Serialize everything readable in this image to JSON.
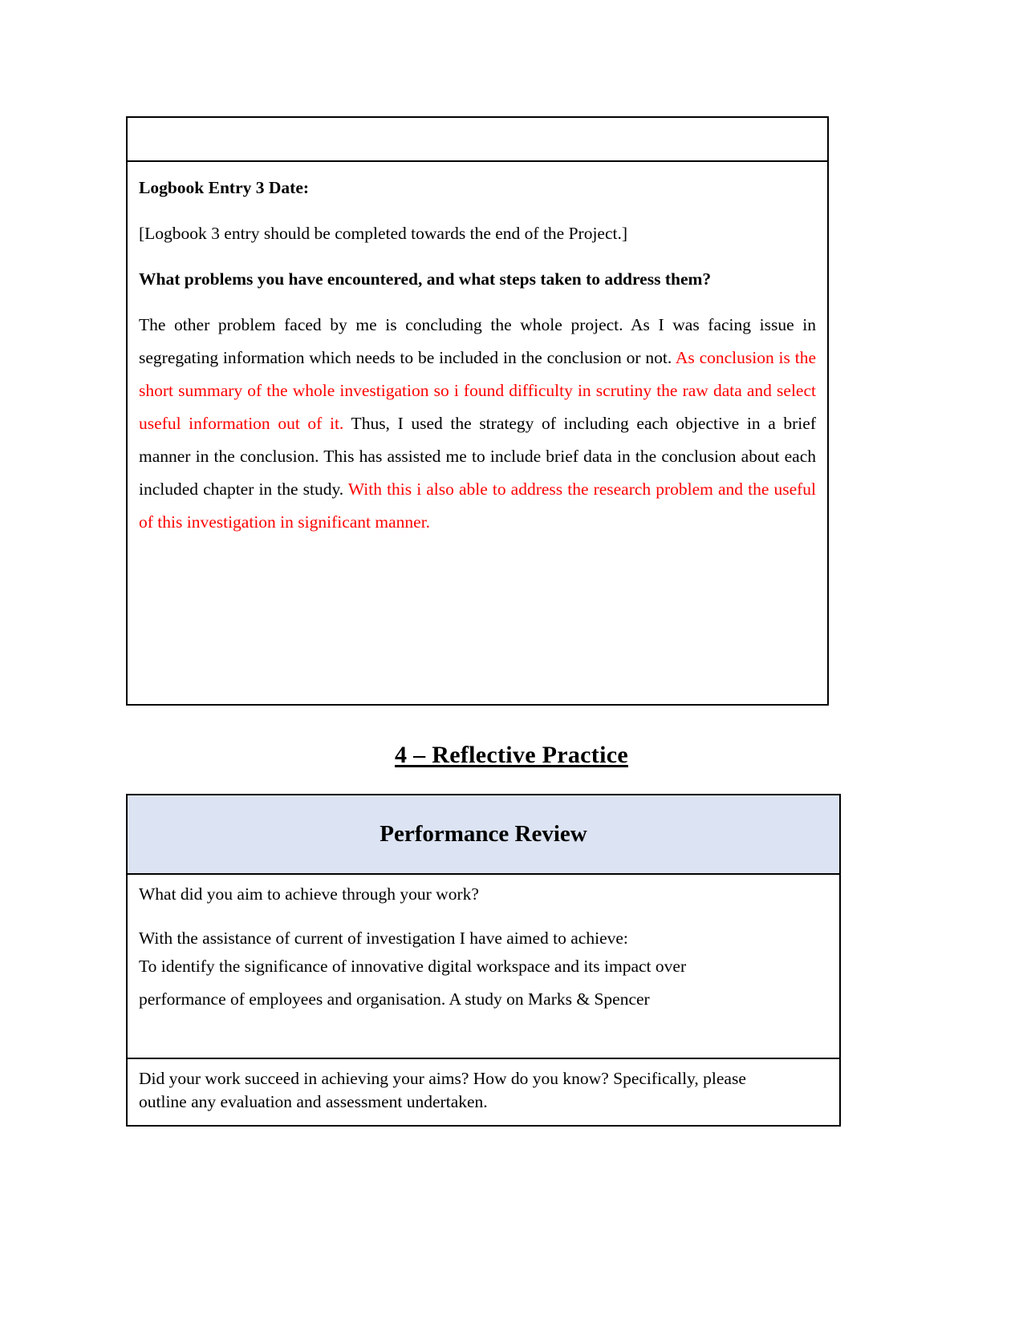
{
  "document": {
    "logbook": {
      "empty_row": "",
      "entry_title": "Logbook Entry 3 Date:",
      "instruction": "[Logbook 3 entry should be completed towards the end of the Project.]",
      "question": "What problems you have encountered, and what steps taken to address them?",
      "answer": {
        "segment_1_black": "The other problem faced by me is concluding the whole project. As I was facing issue in segregating information which needs to be included in the conclusion or not. ",
        "segment_2_red": "As conclusion is the short summary of the whole investigation so i found difficulty in scrutiny the raw data and select useful information out of it.",
        "segment_3_black": " Thus, I used the strategy of including each objective in a brief manner in the conclusion. This has assisted me to include brief data in the conclusion about each included chapter in the study. ",
        "segment_4_red": "With this i also able to address the research problem and the useful of this investigation in significant manner."
      }
    },
    "section_heading": "4 – Reflective Practice",
    "performance_review": {
      "header_title": "Performance Review",
      "aims_question": "What did you aim to achieve through your work?",
      "aims_intro": "With the assistance of current of investigation I have aimed to achieve:",
      "aims_body_line1": "To identify the significance of innovative digital workspace and its impact over",
      "aims_body_line2": "performance of employees and organisation. A study on Marks & Spencer",
      "evaluation_question_line1": "Did your work succeed in achieving your aims? How do you know? Specifically, please",
      "evaluation_question_line2": "outline any evaluation and assessment undertaken."
    }
  },
  "colors": {
    "red_text": "#ff0000",
    "table_header_fill": "#dce3f2",
    "border": "#000000",
    "body_text": "#000000",
    "page_background": "#ffffff"
  }
}
